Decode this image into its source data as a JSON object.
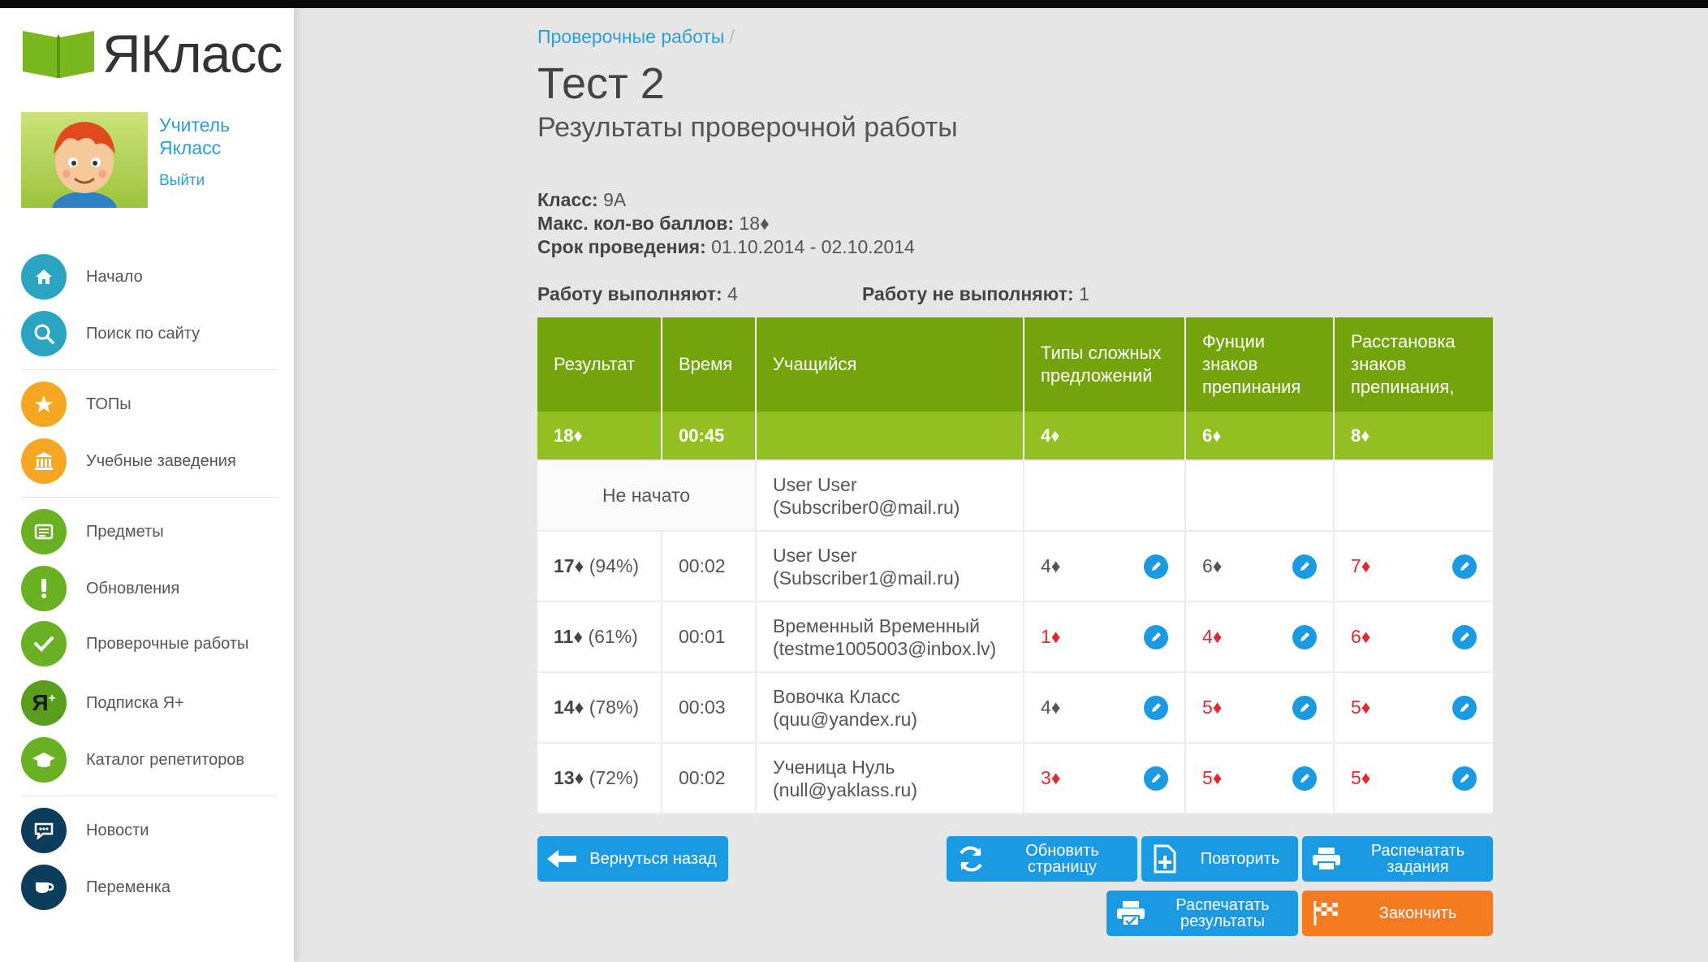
{
  "brand": {
    "name": "ЯКласс",
    "color": "#78b81e"
  },
  "profile": {
    "name": "Учитель Якласс",
    "logout": "Выйти"
  },
  "nav": [
    {
      "label": "Начало",
      "icon": "home-icon",
      "color": "#2aa4c0"
    },
    {
      "label": "Поиск по сайту",
      "icon": "search-icon",
      "color": "#2aa4c0"
    },
    {
      "label": "ТОПы",
      "icon": "star-icon",
      "color": "#f5a623"
    },
    {
      "label": "Учебные заведения",
      "icon": "building-icon",
      "color": "#f5a623"
    },
    {
      "label": "Предметы",
      "icon": "book-icon",
      "color": "#6ab023"
    },
    {
      "label": "Обновления",
      "icon": "exclamation-icon",
      "color": "#6ab023"
    },
    {
      "label": "Проверочные работы",
      "icon": "check-icon",
      "color": "#6ab023"
    },
    {
      "label": "Подписка Я+",
      "icon": "ya-plus-icon",
      "color": "#5a9e1e"
    },
    {
      "label": "Каталог репетиторов",
      "icon": "graduation-cap-icon",
      "color": "#6ab023"
    },
    {
      "label": "Новости",
      "icon": "chat-icon",
      "color": "#0c3d5c"
    },
    {
      "label": "Переменка",
      "icon": "cup-icon",
      "color": "#0c3d5c"
    }
  ],
  "breadcrumb": {
    "link": "Проверочные работы",
    "separator": "/"
  },
  "title": "Тест 2",
  "subtitle": "Результаты проверочной работы",
  "info": {
    "class_label": "Класс:",
    "class_value": "9А",
    "max_label": "Макс. кол-во баллов:",
    "max_value": "18♦",
    "period_label": "Срок проведения:",
    "period_value": "01.10.2014 - 02.10.2014",
    "doing_label": "Работу выполняют:",
    "doing_value": "4",
    "not_doing_label": "Работу не выполняют:",
    "not_doing_value": "1"
  },
  "table": {
    "headers": [
      "Результат",
      "Время",
      "Учащийся",
      "Типы сложных предложений",
      "Фунции знаков препинания",
      "Расстановка знаков препинания,"
    ],
    "max_row": {
      "result": "18♦",
      "time": "00:45",
      "student": "",
      "t1": "4♦",
      "t2": "6♦",
      "t3": "8♦"
    },
    "not_started": {
      "status": "Не начато",
      "student_name": "User User",
      "student_email": "(Subscriber0@mail.ru)"
    },
    "rows": [
      {
        "result": "17♦",
        "percent": "(94%)",
        "time": "00:02",
        "name": "User User",
        "email": "(Subscriber1@mail.ru)",
        "t1": "4♦",
        "t1_ok": true,
        "t2": "6♦",
        "t2_ok": true,
        "t3": "7♦",
        "t3_ok": false
      },
      {
        "result": "11♦",
        "percent": "(61%)",
        "time": "00:01",
        "name": "Временный Временный",
        "email": "(testme1005003@inbox.lv)",
        "t1": "1♦",
        "t1_ok": false,
        "t2": "4♦",
        "t2_ok": false,
        "t3": "6♦",
        "t3_ok": false
      },
      {
        "result": "14♦",
        "percent": "(78%)",
        "time": "00:03",
        "name": "Вовочка Класс",
        "email": "(quu@yandex.ru)",
        "t1": "4♦",
        "t1_ok": true,
        "t2": "5♦",
        "t2_ok": false,
        "t3": "5♦",
        "t3_ok": false
      },
      {
        "result": "13♦",
        "percent": "(72%)",
        "time": "00:02",
        "name": "Ученица Нуль",
        "email": "(null@yaklass.ru)",
        "t1": "3♦",
        "t1_ok": false,
        "t2": "5♦",
        "t2_ok": false,
        "t3": "5♦",
        "t3_ok": false
      }
    ]
  },
  "buttons": {
    "back": "Вернуться назад",
    "refresh": "Обновить страницу",
    "repeat": "Повторить",
    "print_tasks": "Распечатать задания",
    "print_results": "Распечатать результаты",
    "finish": "Закончить"
  },
  "colors": {
    "link": "#2a9fd8",
    "header_green": "#74a40c",
    "max_green": "#92c023",
    "button_blue": "#1a9ae2",
    "button_orange": "#f47b22",
    "error_red": "#e0282e"
  }
}
